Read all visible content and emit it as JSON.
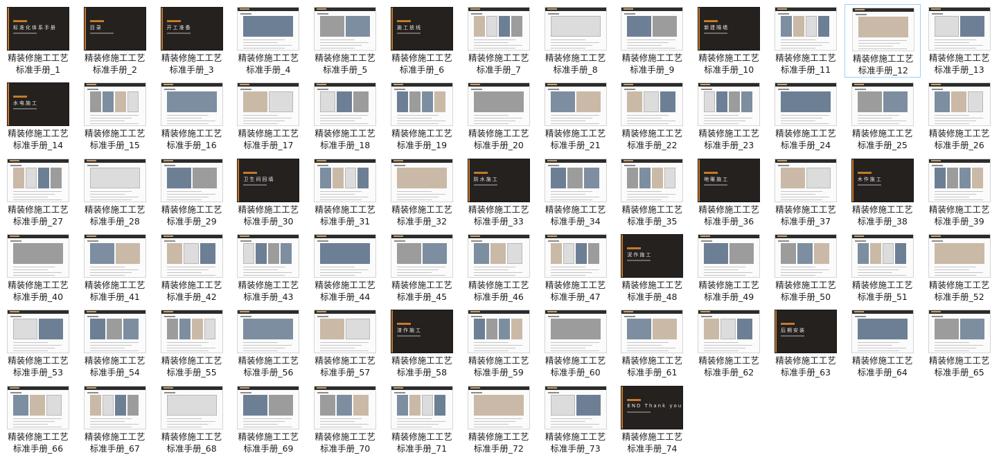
{
  "folder": {
    "title_prefix": "精装修施工工艺",
    "title_suffix_prefix": "标准手册_",
    "selected_index": 12,
    "items": [
      {
        "n": 1,
        "line1": "精装修施工工艺",
        "line2": "标准手册_1",
        "style": "dark",
        "cover_text": "标准化体系手册"
      },
      {
        "n": 2,
        "line1": "精装修施工工艺",
        "line2": "标准手册_2",
        "style": "dark",
        "cover_text": "目录"
      },
      {
        "n": 3,
        "line1": "精装修施工工艺",
        "line2": "标准手册_3",
        "style": "dark",
        "cover_text": "开工准备"
      },
      {
        "n": 4,
        "line1": "精装修施工工艺",
        "line2": "标准手册_4",
        "style": "light"
      },
      {
        "n": 5,
        "line1": "精装修施工工艺",
        "line2": "标准手册_5",
        "style": "light"
      },
      {
        "n": 6,
        "line1": "精装修施工工艺",
        "line2": "标准手册_6",
        "style": "dark",
        "cover_text": "施工放线"
      },
      {
        "n": 7,
        "line1": "精装修施工工艺",
        "line2": "标准手册_7",
        "style": "light"
      },
      {
        "n": 8,
        "line1": "精装修施工工艺",
        "line2": "标准手册_8",
        "style": "light"
      },
      {
        "n": 9,
        "line1": "精装修施工工艺",
        "line2": "标准手册_9",
        "style": "light"
      },
      {
        "n": 10,
        "line1": "精装修施工工艺",
        "line2": "标准手册_10",
        "style": "dark",
        "cover_text": "新建隔墙"
      },
      {
        "n": 11,
        "line1": "精装修施工工艺",
        "line2": "标准手册_11",
        "style": "light"
      },
      {
        "n": 12,
        "line1": "精装修施工工艺",
        "line2": "标准手册_12",
        "style": "light"
      },
      {
        "n": 13,
        "line1": "精装修施工工艺",
        "line2": "标准手册_13",
        "style": "light"
      },
      {
        "n": 14,
        "line1": "精装修施工工艺",
        "line2": "标准手册_14",
        "style": "dark",
        "cover_text": "水电施工"
      },
      {
        "n": 15,
        "line1": "精装修施工工艺",
        "line2": "标准手册_15",
        "style": "light"
      },
      {
        "n": 16,
        "line1": "精装修施工工艺",
        "line2": "标准手册_16",
        "style": "light"
      },
      {
        "n": 17,
        "line1": "精装修施工工艺",
        "line2": "标准手册_17",
        "style": "light"
      },
      {
        "n": 18,
        "line1": "精装修施工工艺",
        "line2": "标准手册_18",
        "style": "light"
      },
      {
        "n": 19,
        "line1": "精装修施工工艺",
        "line2": "标准手册_19",
        "style": "light"
      },
      {
        "n": 20,
        "line1": "精装修施工工艺",
        "line2": "标准手册_20",
        "style": "light"
      },
      {
        "n": 21,
        "line1": "精装修施工工艺",
        "line2": "标准手册_21",
        "style": "light"
      },
      {
        "n": 22,
        "line1": "精装修施工工艺",
        "line2": "标准手册_22",
        "style": "light"
      },
      {
        "n": 23,
        "line1": "精装修施工工艺",
        "line2": "标准手册_23",
        "style": "light"
      },
      {
        "n": 24,
        "line1": "精装修施工工艺",
        "line2": "标准手册_24",
        "style": "light"
      },
      {
        "n": 25,
        "line1": "精装修施工工艺",
        "line2": "标准手册_25",
        "style": "light"
      },
      {
        "n": 26,
        "line1": "精装修施工工艺",
        "line2": "标准手册_26",
        "style": "light"
      },
      {
        "n": 27,
        "line1": "精装修施工工艺",
        "line2": "标准手册_27",
        "style": "light"
      },
      {
        "n": 28,
        "line1": "精装修施工工艺",
        "line2": "标准手册_28",
        "style": "light"
      },
      {
        "n": 29,
        "line1": "精装修施工工艺",
        "line2": "标准手册_29",
        "style": "light"
      },
      {
        "n": 30,
        "line1": "精装修施工工艺",
        "line2": "标准手册_30",
        "style": "dark",
        "cover_text": "卫生间回填"
      },
      {
        "n": 31,
        "line1": "精装修施工工艺",
        "line2": "标准手册_31",
        "style": "light"
      },
      {
        "n": 32,
        "line1": "精装修施工工艺",
        "line2": "标准手册_32",
        "style": "light"
      },
      {
        "n": 33,
        "line1": "精装修施工工艺",
        "line2": "标准手册_33",
        "style": "dark",
        "cover_text": "防水施工"
      },
      {
        "n": 34,
        "line1": "精装修施工工艺",
        "line2": "标准手册_34",
        "style": "light"
      },
      {
        "n": 35,
        "line1": "精装修施工工艺",
        "line2": "标准手册_35",
        "style": "light"
      },
      {
        "n": 36,
        "line1": "精装修施工工艺",
        "line2": "标准手册_36",
        "style": "dark",
        "cover_text": "地暖施工"
      },
      {
        "n": 37,
        "line1": "精装修施工工艺",
        "line2": "标准手册_37",
        "style": "light"
      },
      {
        "n": 38,
        "line1": "精装修施工工艺",
        "line2": "标准手册_38",
        "style": "dark",
        "cover_text": "木作施工"
      },
      {
        "n": 39,
        "line1": "精装修施工工艺",
        "line2": "标准手册_39",
        "style": "light"
      },
      {
        "n": 40,
        "line1": "精装修施工工艺",
        "line2": "标准手册_40",
        "style": "light"
      },
      {
        "n": 41,
        "line1": "精装修施工工艺",
        "line2": "标准手册_41",
        "style": "light"
      },
      {
        "n": 42,
        "line1": "精装修施工工艺",
        "line2": "标准手册_42",
        "style": "light"
      },
      {
        "n": 43,
        "line1": "精装修施工工艺",
        "line2": "标准手册_43",
        "style": "light"
      },
      {
        "n": 44,
        "line1": "精装修施工工艺",
        "line2": "标准手册_44",
        "style": "light"
      },
      {
        "n": 45,
        "line1": "精装修施工工艺",
        "line2": "标准手册_45",
        "style": "light"
      },
      {
        "n": 46,
        "line1": "精装修施工工艺",
        "line2": "标准手册_46",
        "style": "light"
      },
      {
        "n": 47,
        "line1": "精装修施工工艺",
        "line2": "标准手册_47",
        "style": "light"
      },
      {
        "n": 48,
        "line1": "精装修施工工艺",
        "line2": "标准手册_48",
        "style": "dark",
        "cover_text": "泥作施工"
      },
      {
        "n": 49,
        "line1": "精装修施工工艺",
        "line2": "标准手册_49",
        "style": "light"
      },
      {
        "n": 50,
        "line1": "精装修施工工艺",
        "line2": "标准手册_50",
        "style": "light"
      },
      {
        "n": 51,
        "line1": "精装修施工工艺",
        "line2": "标准手册_51",
        "style": "light"
      },
      {
        "n": 52,
        "line1": "精装修施工工艺",
        "line2": "标准手册_52",
        "style": "light"
      },
      {
        "n": 53,
        "line1": "精装修施工工艺",
        "line2": "标准手册_53",
        "style": "light"
      },
      {
        "n": 54,
        "line1": "精装修施工工艺",
        "line2": "标准手册_54",
        "style": "light"
      },
      {
        "n": 55,
        "line1": "精装修施工工艺",
        "line2": "标准手册_55",
        "style": "light"
      },
      {
        "n": 56,
        "line1": "精装修施工工艺",
        "line2": "标准手册_56",
        "style": "light"
      },
      {
        "n": 57,
        "line1": "精装修施工工艺",
        "line2": "标准手册_57",
        "style": "light"
      },
      {
        "n": 58,
        "line1": "精装修施工工艺",
        "line2": "标准手册_58",
        "style": "dark",
        "cover_text": "漆作施工"
      },
      {
        "n": 59,
        "line1": "精装修施工工艺",
        "line2": "标准手册_59",
        "style": "light"
      },
      {
        "n": 60,
        "line1": "精装修施工工艺",
        "line2": "标准手册_60",
        "style": "light"
      },
      {
        "n": 61,
        "line1": "精装修施工工艺",
        "line2": "标准手册_61",
        "style": "light"
      },
      {
        "n": 62,
        "line1": "精装修施工工艺",
        "line2": "标准手册_62",
        "style": "light"
      },
      {
        "n": 63,
        "line1": "精装修施工工艺",
        "line2": "标准手册_63",
        "style": "dark",
        "cover_text": "后期安装"
      },
      {
        "n": 64,
        "line1": "精装修施工工艺",
        "line2": "标准手册_64",
        "style": "light"
      },
      {
        "n": 65,
        "line1": "精装修施工工艺",
        "line2": "标准手册_65",
        "style": "light"
      },
      {
        "n": 66,
        "line1": "精装修施工工艺",
        "line2": "标准手册_66",
        "style": "light"
      },
      {
        "n": 67,
        "line1": "精装修施工工艺",
        "line2": "标准手册_67",
        "style": "light"
      },
      {
        "n": 68,
        "line1": "精装修施工工艺",
        "line2": "标准手册_68",
        "style": "light"
      },
      {
        "n": 69,
        "line1": "精装修施工工艺",
        "line2": "标准手册_69",
        "style": "light"
      },
      {
        "n": 70,
        "line1": "精装修施工工艺",
        "line2": "标准手册_70",
        "style": "light"
      },
      {
        "n": 71,
        "line1": "精装修施工工艺",
        "line2": "标准手册_71",
        "style": "light"
      },
      {
        "n": 72,
        "line1": "精装修施工工艺",
        "line2": "标准手册_72",
        "style": "light"
      },
      {
        "n": 73,
        "line1": "精装修施工工艺",
        "line2": "标准手册_73",
        "style": "light"
      },
      {
        "n": 74,
        "line1": "精装修施工工艺",
        "line2": "标准手册_74",
        "style": "dark",
        "cover_text": "END Thank you"
      }
    ]
  },
  "colors": {
    "selection_border": "#99d1ff",
    "dark_slide": "#25211f",
    "accent_orange": "#c47a2a",
    "label_text": "#1a1a1a"
  }
}
